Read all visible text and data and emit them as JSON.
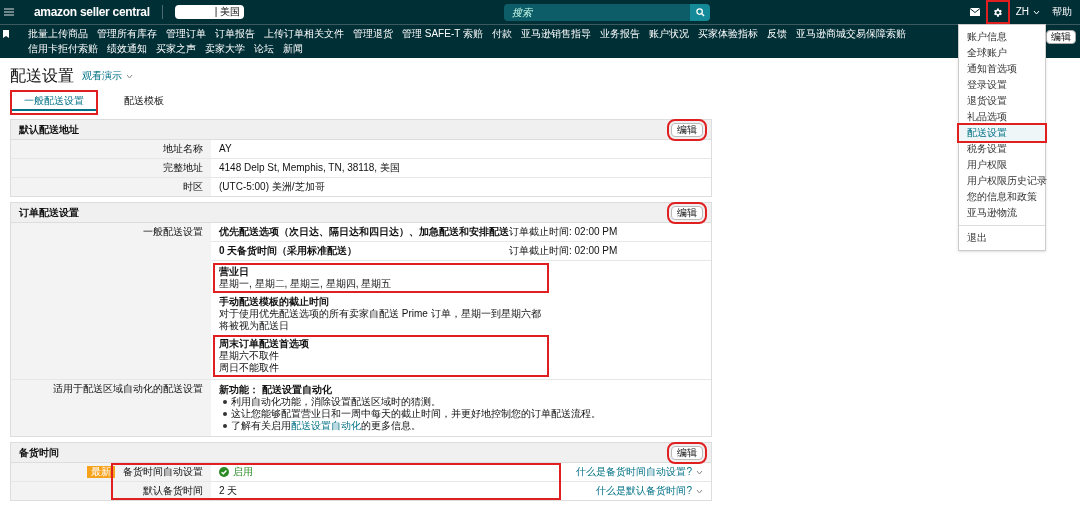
{
  "top_bar": {
    "logo": "amazon seller central",
    "marketplace": "| 美国",
    "search": {
      "placeholder": "搜索"
    },
    "gear_highlighted": true,
    "language": "ZH",
    "help": "帮助"
  },
  "nav": {
    "items": [
      "批量上传商品",
      "管理所有库存",
      "管理订单",
      "订单报告",
      "上传订单相关文件",
      "管理退货",
      "管理 SAFE-T 索赔",
      "付款",
      "亚马逊销售指导",
      "业务报告",
      "账户状况",
      "买家体验指标",
      "反馈",
      "亚马逊商城交易保障索赔",
      "信用卡拒付索赔",
      "绩效通知",
      "买家之声",
      "卖家大学",
      "论坛",
      "新闻"
    ],
    "edit_button": "编辑"
  },
  "settings_menu": {
    "items": [
      {
        "label": "账户信息",
        "selected": false,
        "highlighted": false
      },
      {
        "label": "全球账户",
        "selected": false,
        "highlighted": false
      },
      {
        "label": "通知首选项",
        "selected": false,
        "highlighted": false
      },
      {
        "label": "登录设置",
        "selected": false,
        "highlighted": false
      },
      {
        "label": "退货设置",
        "selected": false,
        "highlighted": false
      },
      {
        "label": "礼品选项",
        "selected": false,
        "highlighted": false
      },
      {
        "label": "配送设置",
        "selected": true,
        "highlighted": true
      },
      {
        "label": "税务设置",
        "selected": false,
        "highlighted": false
      },
      {
        "label": "用户权限",
        "selected": false,
        "highlighted": false
      },
      {
        "label": "用户权限历史记录",
        "selected": false,
        "highlighted": false
      },
      {
        "label": "您的信息和政策",
        "selected": false,
        "highlighted": false
      },
      {
        "label": "亚马逊物流",
        "selected": false,
        "highlighted": false
      }
    ],
    "logout": "退出"
  },
  "page": {
    "title": "配送设置",
    "demo_link": "观看演示"
  },
  "tabs": [
    {
      "label": "一般配送设置",
      "selected": true,
      "highlighted": true
    },
    {
      "label": "配送模板",
      "selected": false,
      "highlighted": false
    }
  ],
  "sections": [
    {
      "title": "默认配送地址",
      "edit_button": "编辑",
      "edit_highlighted": true,
      "rows_highlighted": false,
      "rows": [
        {
          "kind": "text",
          "label": "地址名称",
          "value": "AY"
        },
        {
          "kind": "text",
          "label": "完整地址",
          "value": "4148 Delp St, Memphis, TN, 38118, 美国"
        },
        {
          "kind": "text",
          "label": "时区",
          "value": "(UTC-5:00) 美洲/芝加哥"
        }
      ]
    },
    {
      "title": "订单配送设置",
      "edit_button": "编辑",
      "edit_highlighted": true,
      "rows_highlighted": false,
      "rows": [
        {
          "kind": "shipping",
          "label": "一般配送设置",
          "lines": [
            {
              "text": "优先配送选项（次日达、隔日达和四日达）、加急配送和安排配送",
              "cutoff": "订单截止时间: 02:00 PM"
            },
            {
              "text": "0 天备货时间（采用标准配送）",
              "cutoff": "订单截止时间: 02:00 PM"
            }
          ],
          "blocks": [
            {
              "title": "营业日",
              "lines": [
                "星期一, 星期二, 星期三, 星期四, 星期五"
              ],
              "highlighted": true
            },
            {
              "title": "手动配送模板的截止时间",
              "lines": [
                "对于使用优先配送选项的所有卖家自配送 Prime 订单，星期一到星期六都将被视为配送日"
              ],
              "highlighted": false
            },
            {
              "title": "周末订单配送首选项",
              "lines": [
                "星期六不取件",
                "周日不能取件"
              ],
              "highlighted": true
            }
          ]
        },
        {
          "kind": "feature",
          "label": "适用于配送区域自动化的配送设置",
          "heading": "新功能： 配送设置自动化",
          "bullets": [
            {
              "text": "利用自动化功能，消除设置配送区域时的猜测。"
            },
            {
              "text": "这让您能够配置营业日和一周中每天的截止时间，并更好地控制您的订单配送流程。"
            },
            {
              "text": "了解有关启用",
              "link": "配送设置自动化",
              "after": "的更多信息。"
            }
          ]
        }
      ]
    },
    {
      "title": "备货时间",
      "edit_button": "编辑",
      "edit_highlighted": true,
      "rows_highlighted": true,
      "rows": [
        {
          "kind": "status",
          "badge": "最新",
          "label": "备货时间自动设置",
          "value": "启用",
          "help": "什么是备货时间自动设置?"
        },
        {
          "kind": "status",
          "label": "默认备货时间",
          "value": "2 天",
          "help": "什么是默认备货时间?"
        }
      ]
    }
  ]
}
